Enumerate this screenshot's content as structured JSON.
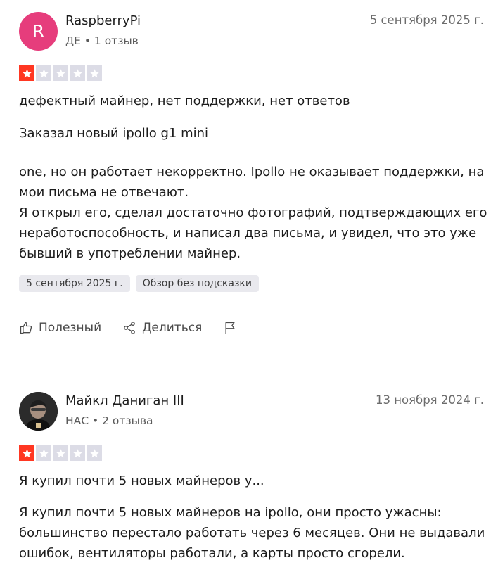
{
  "reviews": [
    {
      "avatar_letter": "R",
      "name": "RaspberryPi",
      "meta": "ДЕ • 1 отзыв",
      "date": "5 сентября 2025 г.",
      "rating": 1,
      "title": "дефектный майнер, нет поддержки, нет ответов",
      "body1": "Заказал новый ipollo g1 mini",
      "body2": "one, но он работает некорректно. Ipollo не оказывает поддержки, на мои письма не отвечают.\nЯ открыл его, сделал достаточно фотографий, подтверждающих его неработоспособность, и написал два письма, и увидел, что это уже бывший в употреблении майнер.",
      "tag_date": "5 сентября 2025 г.",
      "tag_type": "Обзор без подсказки",
      "useful_label": "Полезный",
      "share_label": "Делиться"
    },
    {
      "name": "Майкл Даниган III",
      "meta": "НАС • 2 отзыва",
      "date": "13 ноября 2024 г.",
      "rating": 1,
      "title": "Я купил почти 5 новых майнеров у...",
      "body1": "Я купил почти 5 новых майнеров на ipollo, они просто ужасны: большинство перестало работать через 6 месяцев. Они не выдавали ошибок, вентиляторы работали, а карты просто сгорели."
    }
  ],
  "colors": {
    "star_active": "#ff3722",
    "star_inactive": "#dcdce6",
    "avatar_pink": "#e63d7c"
  }
}
